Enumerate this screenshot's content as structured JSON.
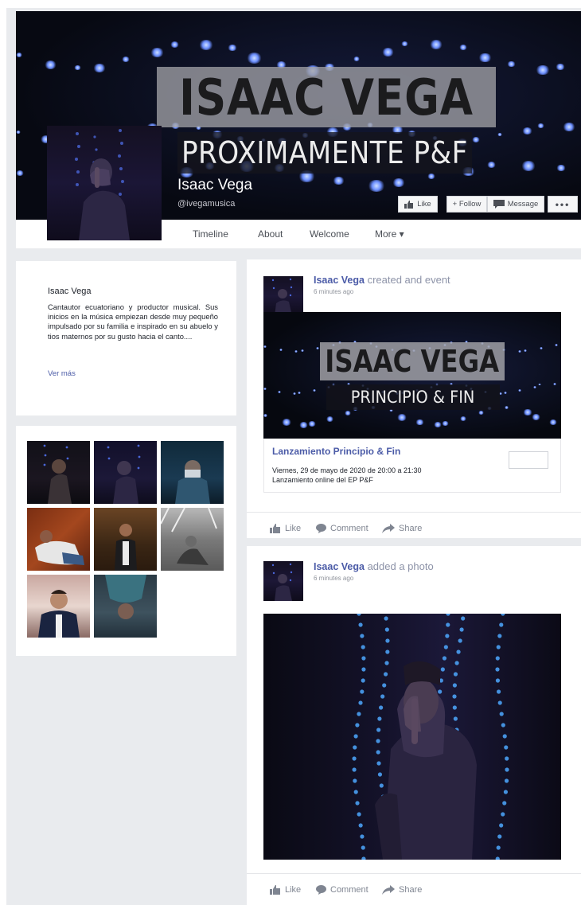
{
  "cover": {
    "title": "ISAAC VEGA",
    "subtitle": "PROXIMAMENTE P&F",
    "name": "Isaac Vega",
    "handle": "@ivegamusica",
    "buttons": {
      "like": "Like",
      "follow": "+ Follow",
      "message": "Message",
      "more": "•••"
    }
  },
  "nav": {
    "items": [
      "Timeline",
      "About",
      "Welcome",
      "More ▾"
    ]
  },
  "about": {
    "name": "Isaac Vega",
    "text": "Cantautor ecuatoriano y productor musical. Sus inicios en la música empiezan desde muy pequeño impulsado por su familia e inspirado en su abuelo y tios maternos por su gusto hacia el canto....",
    "more": "Ver más"
  },
  "post1": {
    "author": "Isaac Vega",
    "action": "created and event",
    "time": "6 minutes ago",
    "image_title": "ISAAC VEGA",
    "image_subtitle": "PRINCIPIO & FIN",
    "event_name": "Lanzamiento Principio & Fin",
    "event_date": "Viernes, 29 de mayo de 2020 de 20:00 a 21:30",
    "event_desc": "Lanzamiento online del EP P&F",
    "actions": {
      "like": "Like",
      "comment": "Comment",
      "share": "Share"
    }
  },
  "post2": {
    "author": "Isaac Vega",
    "action": "added a photo",
    "time": "6 minutes ago",
    "actions": {
      "like": "Like",
      "comment": "Comment",
      "share": "Share"
    }
  },
  "colors": {
    "link": "#4b5ba7",
    "background": "#e9ebee",
    "muted": "#7f8591"
  }
}
